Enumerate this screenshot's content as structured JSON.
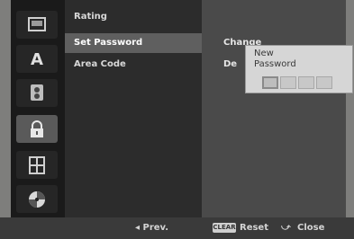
{
  "menu": {
    "items": [
      "Rating",
      "Set Password",
      "Area Code"
    ],
    "selected_index": 1
  },
  "submenu": {
    "option1": "Change",
    "option2": "De"
  },
  "popup": {
    "title": "New Password",
    "digits": [
      "",
      "",
      "",
      ""
    ]
  },
  "footer": {
    "prev": "◂ Prev.",
    "clear_label": "CLEAR",
    "reset": "Reset",
    "close_icon": "⤻",
    "close": "Close"
  },
  "icons": [
    "disc-tray-icon",
    "language-icon",
    "audio-icon",
    "lock-icon",
    "film-icon",
    "disc-icon"
  ],
  "selected_icon_index": 3,
  "colors": {
    "background": "#7e7e7c",
    "panel": "#2c2c2c",
    "selected": "#5f5f5f",
    "popup": "#d6d6d6"
  }
}
